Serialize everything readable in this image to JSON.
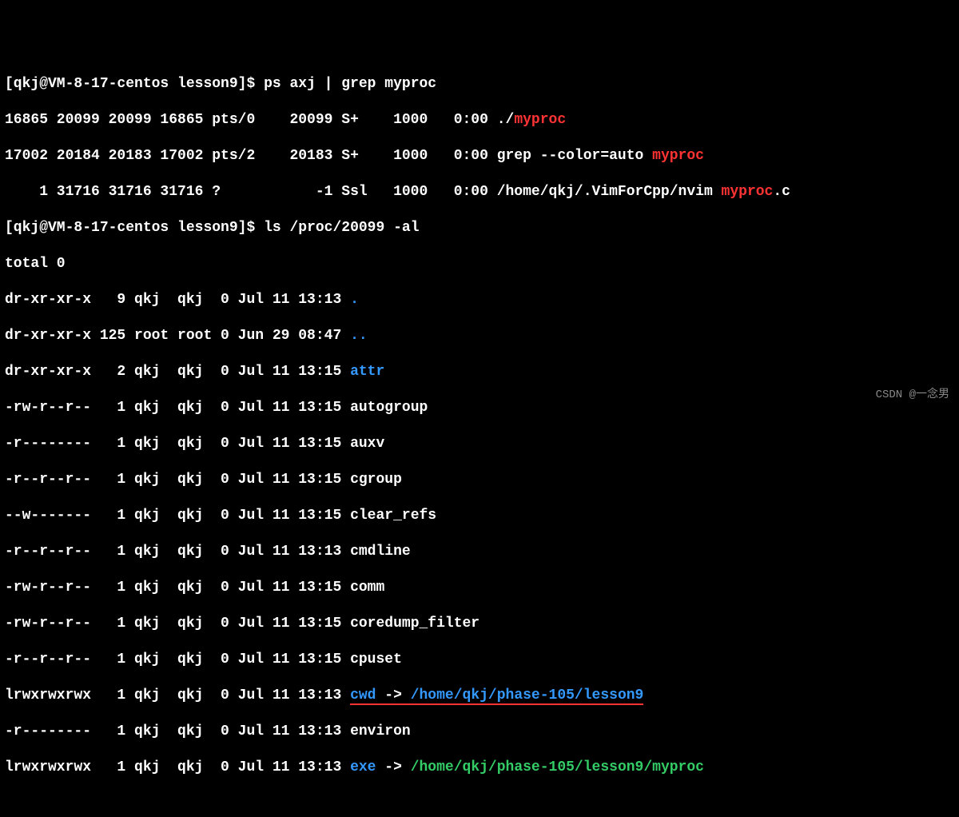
{
  "prompt1": {
    "user_host": "[qkj@VM-8-17-centos lesson9]$ ",
    "cmd": "ps axj | grep myproc"
  },
  "ps": [
    {
      "prefix": "16865 20099 20099 16865 pts/0    20099 S+    1000   0:00 ./",
      "hl": "myproc",
      "suffix": ""
    },
    {
      "prefix": "17002 20184 20183 17002 pts/2    20183 S+    1000   0:00 grep --color=auto ",
      "hl": "myproc",
      "suffix": ""
    },
    {
      "prefix": "    1 31716 31716 31716 ?           -1 Ssl   1000   0:00 /home/qkj/.VimForCpp/nvim ",
      "hl": "myproc",
      "suffix": ".c"
    }
  ],
  "prompt2": {
    "user_host": "[qkj@VM-8-17-centos lesson9]$ ",
    "cmd": "ls /proc/20099 -al"
  },
  "total": "total 0",
  "ls": [
    {
      "l": "dr-xr-xr-x   9 qkj  qkj  0 Jul 11 13:13 ",
      "name": ".",
      "cls": "cyan"
    },
    {
      "l": "dr-xr-xr-x 125 root root 0 Jun 29 08:47 ",
      "name": "..",
      "cls": "cyan"
    },
    {
      "l": "dr-xr-xr-x   2 qkj  qkj  0 Jul 11 13:15 ",
      "name": "attr",
      "cls": "cyan"
    },
    {
      "l": "-rw-r--r--   1 qkj  qkj  0 Jul 11 13:15 ",
      "name": "autogroup",
      "cls": "white"
    },
    {
      "l": "-r--------   1 qkj  qkj  0 Jul 11 13:15 ",
      "name": "auxv",
      "cls": "white"
    },
    {
      "l": "-r--r--r--   1 qkj  qkj  0 Jul 11 13:15 ",
      "name": "cgroup",
      "cls": "white"
    },
    {
      "l": "--w-------   1 qkj  qkj  0 Jul 11 13:15 ",
      "name": "clear_refs",
      "cls": "white"
    },
    {
      "l": "-r--r--r--   1 qkj  qkj  0 Jul 11 13:13 ",
      "name": "cmdline",
      "cls": "white"
    },
    {
      "l": "-rw-r--r--   1 qkj  qkj  0 Jul 11 13:15 ",
      "name": "comm",
      "cls": "white"
    },
    {
      "l": "-rw-r--r--   1 qkj  qkj  0 Jul 11 13:15 ",
      "name": "coredump_filter",
      "cls": "white"
    },
    {
      "l": "-r--r--r--   1 qkj  qkj  0 Jul 11 13:15 ",
      "name": "cpuset",
      "cls": "white"
    }
  ],
  "cwd": {
    "l": "lrwxrwxrwx   1 qkj  qkj  0 Jul 11 13:13 ",
    "link": "cwd",
    "arrow": " -> ",
    "target": "/home/qkj/phase-105/lesson9"
  },
  "environ": {
    "l": "-r--------   1 qkj  qkj  0 Jul 11 13:13 ",
    "name": "environ"
  },
  "exe": {
    "l": "lrwxrwxrwx   1 qkj  qkj  0 Jul 11 13:13 ",
    "link": "exe",
    "arrow": " -> ",
    "target": "/home/qkj/phase-105/lesson9/myproc"
  },
  "watermark": "CSDN @一念男"
}
